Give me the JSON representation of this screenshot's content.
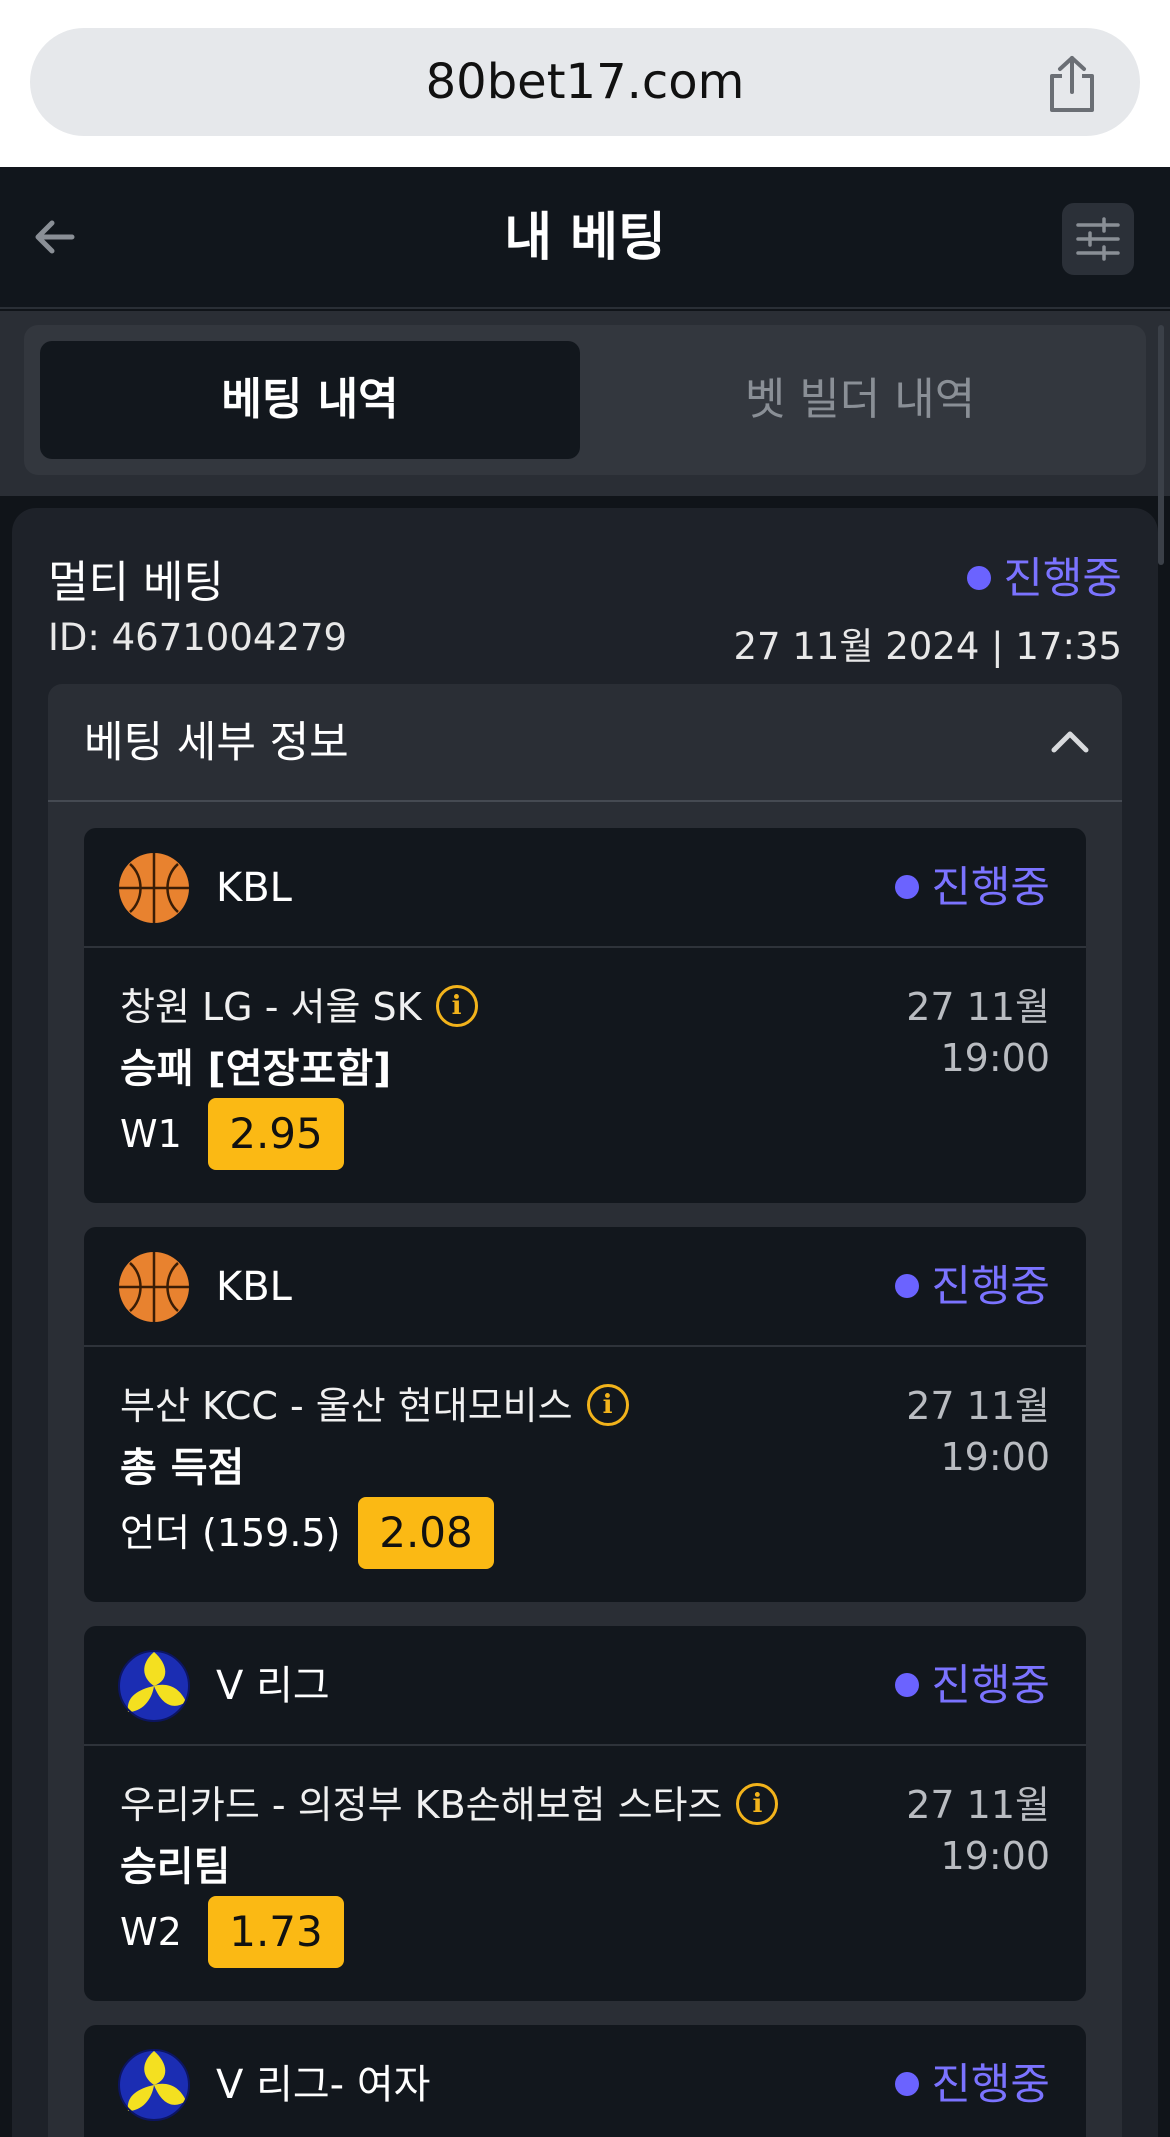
{
  "browser": {
    "url": "80bet17.com"
  },
  "header": {
    "title": "내 베팅"
  },
  "tabs": [
    {
      "label": "베팅 내역",
      "active": true
    },
    {
      "label": "벳 빌더 내역",
      "active": false
    }
  ],
  "bet": {
    "type": "멀티 베팅",
    "status": "진행중",
    "id": "ID: 4671004279",
    "placed": "27 11월 2024 | 17:35",
    "details_title": "베팅 세부 정보"
  },
  "events": [
    {
      "sport_icon": "basketball-icon",
      "league": "KBL",
      "status": "진행중",
      "match": "창원 LG - 서울 SK",
      "date": "27 11월",
      "time": "19:00",
      "market": "승패 [연장포함]",
      "pick": "W1",
      "odds": "2.95"
    },
    {
      "sport_icon": "basketball-icon",
      "league": "KBL",
      "status": "진행중",
      "match": "부산 KCC - 울산 현대모비스",
      "date": "27 11월",
      "time": "19:00",
      "market": "총 득점",
      "pick": "언더 (159.5)",
      "odds": "2.08"
    },
    {
      "sport_icon": "volleyball-icon",
      "league": "V 리그",
      "status": "진행중",
      "match": "우리카드 - 의정부 KB손해보험 스타즈",
      "date": "27 11월",
      "time": "19:00",
      "market": "승리팀",
      "pick": "W2",
      "odds": "1.73"
    },
    {
      "sport_icon": "volleyball-icon",
      "league": "V 리그- 여자",
      "status": "진행중"
    }
  ],
  "colors": {
    "status": "#7b73ff",
    "odds_bg": "#fbb914",
    "info": "#f2b31b",
    "background": "#101419"
  }
}
